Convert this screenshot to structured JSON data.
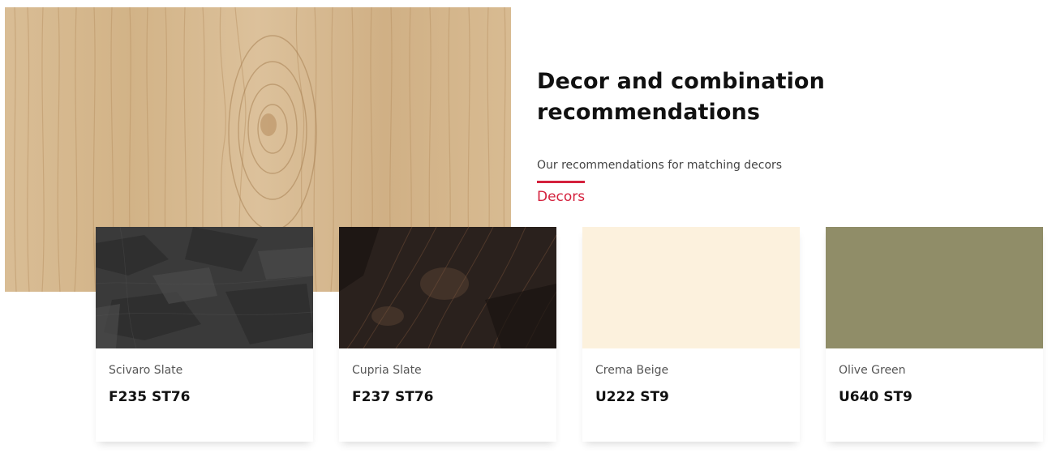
{
  "hero": {
    "image": "oak-wood-texture",
    "base_color": "#d6b88f"
  },
  "intro": {
    "title": "Decor and combination recommendations",
    "subtitle": "Our recommendations for matching decors"
  },
  "tabs": [
    {
      "label": "Decors",
      "active": true,
      "accent": "#d4213d"
    }
  ],
  "cards": [
    {
      "name": "Scivaro Slate",
      "code": "F235 ST76",
      "swatch": "dark-grey-slate-texture",
      "color": "#3a3a3a"
    },
    {
      "name": "Cupria Slate",
      "code": "F237 ST76",
      "swatch": "black-bronze-slate-texture",
      "color": "#2a211d"
    },
    {
      "name": "Crema Beige",
      "code": "U222 ST9",
      "swatch": "solid-beige",
      "color": "#fcf1dd"
    },
    {
      "name": "Olive Green",
      "code": "U640 ST9",
      "swatch": "solid-olive",
      "color": "#908d68"
    }
  ]
}
